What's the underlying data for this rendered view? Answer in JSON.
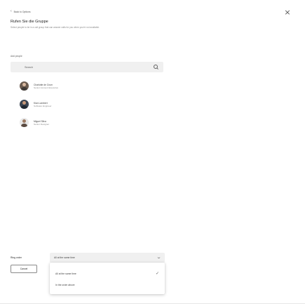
{
  "header": {
    "back_label": "Back to Options",
    "close_glyph": "×",
    "title": "Rufen Sie die Gruppe",
    "subtitle": "Select people to be in a call group that can answer calls for you when you're not available."
  },
  "add_people": {
    "label": "Add people",
    "search_placeholder": "Search"
  },
  "people": [
    {
      "name": "Charlotte de Crum",
      "role": "Senior Account Executive",
      "avatar_bg": "#6b5b4f",
      "head": "#d9b9a0",
      "body": "#3f3a36"
    },
    {
      "name": "Kian Lambert",
      "role": "Software Engineer",
      "avatar_bg": "#3b4552",
      "head": "#c89878",
      "body": "#1f2630"
    },
    {
      "name": "Miguel Silva",
      "role": "Senior Designer",
      "avatar_bg": "#e8e8e8",
      "head": "#9c7a62",
      "body": "#5a4a40"
    }
  ],
  "ring_order": {
    "label": "Ring order",
    "selected": "All at the same time",
    "options": [
      "All at the same time",
      "In the order above"
    ]
  },
  "footer": {
    "cancel_label": "Cancel"
  }
}
